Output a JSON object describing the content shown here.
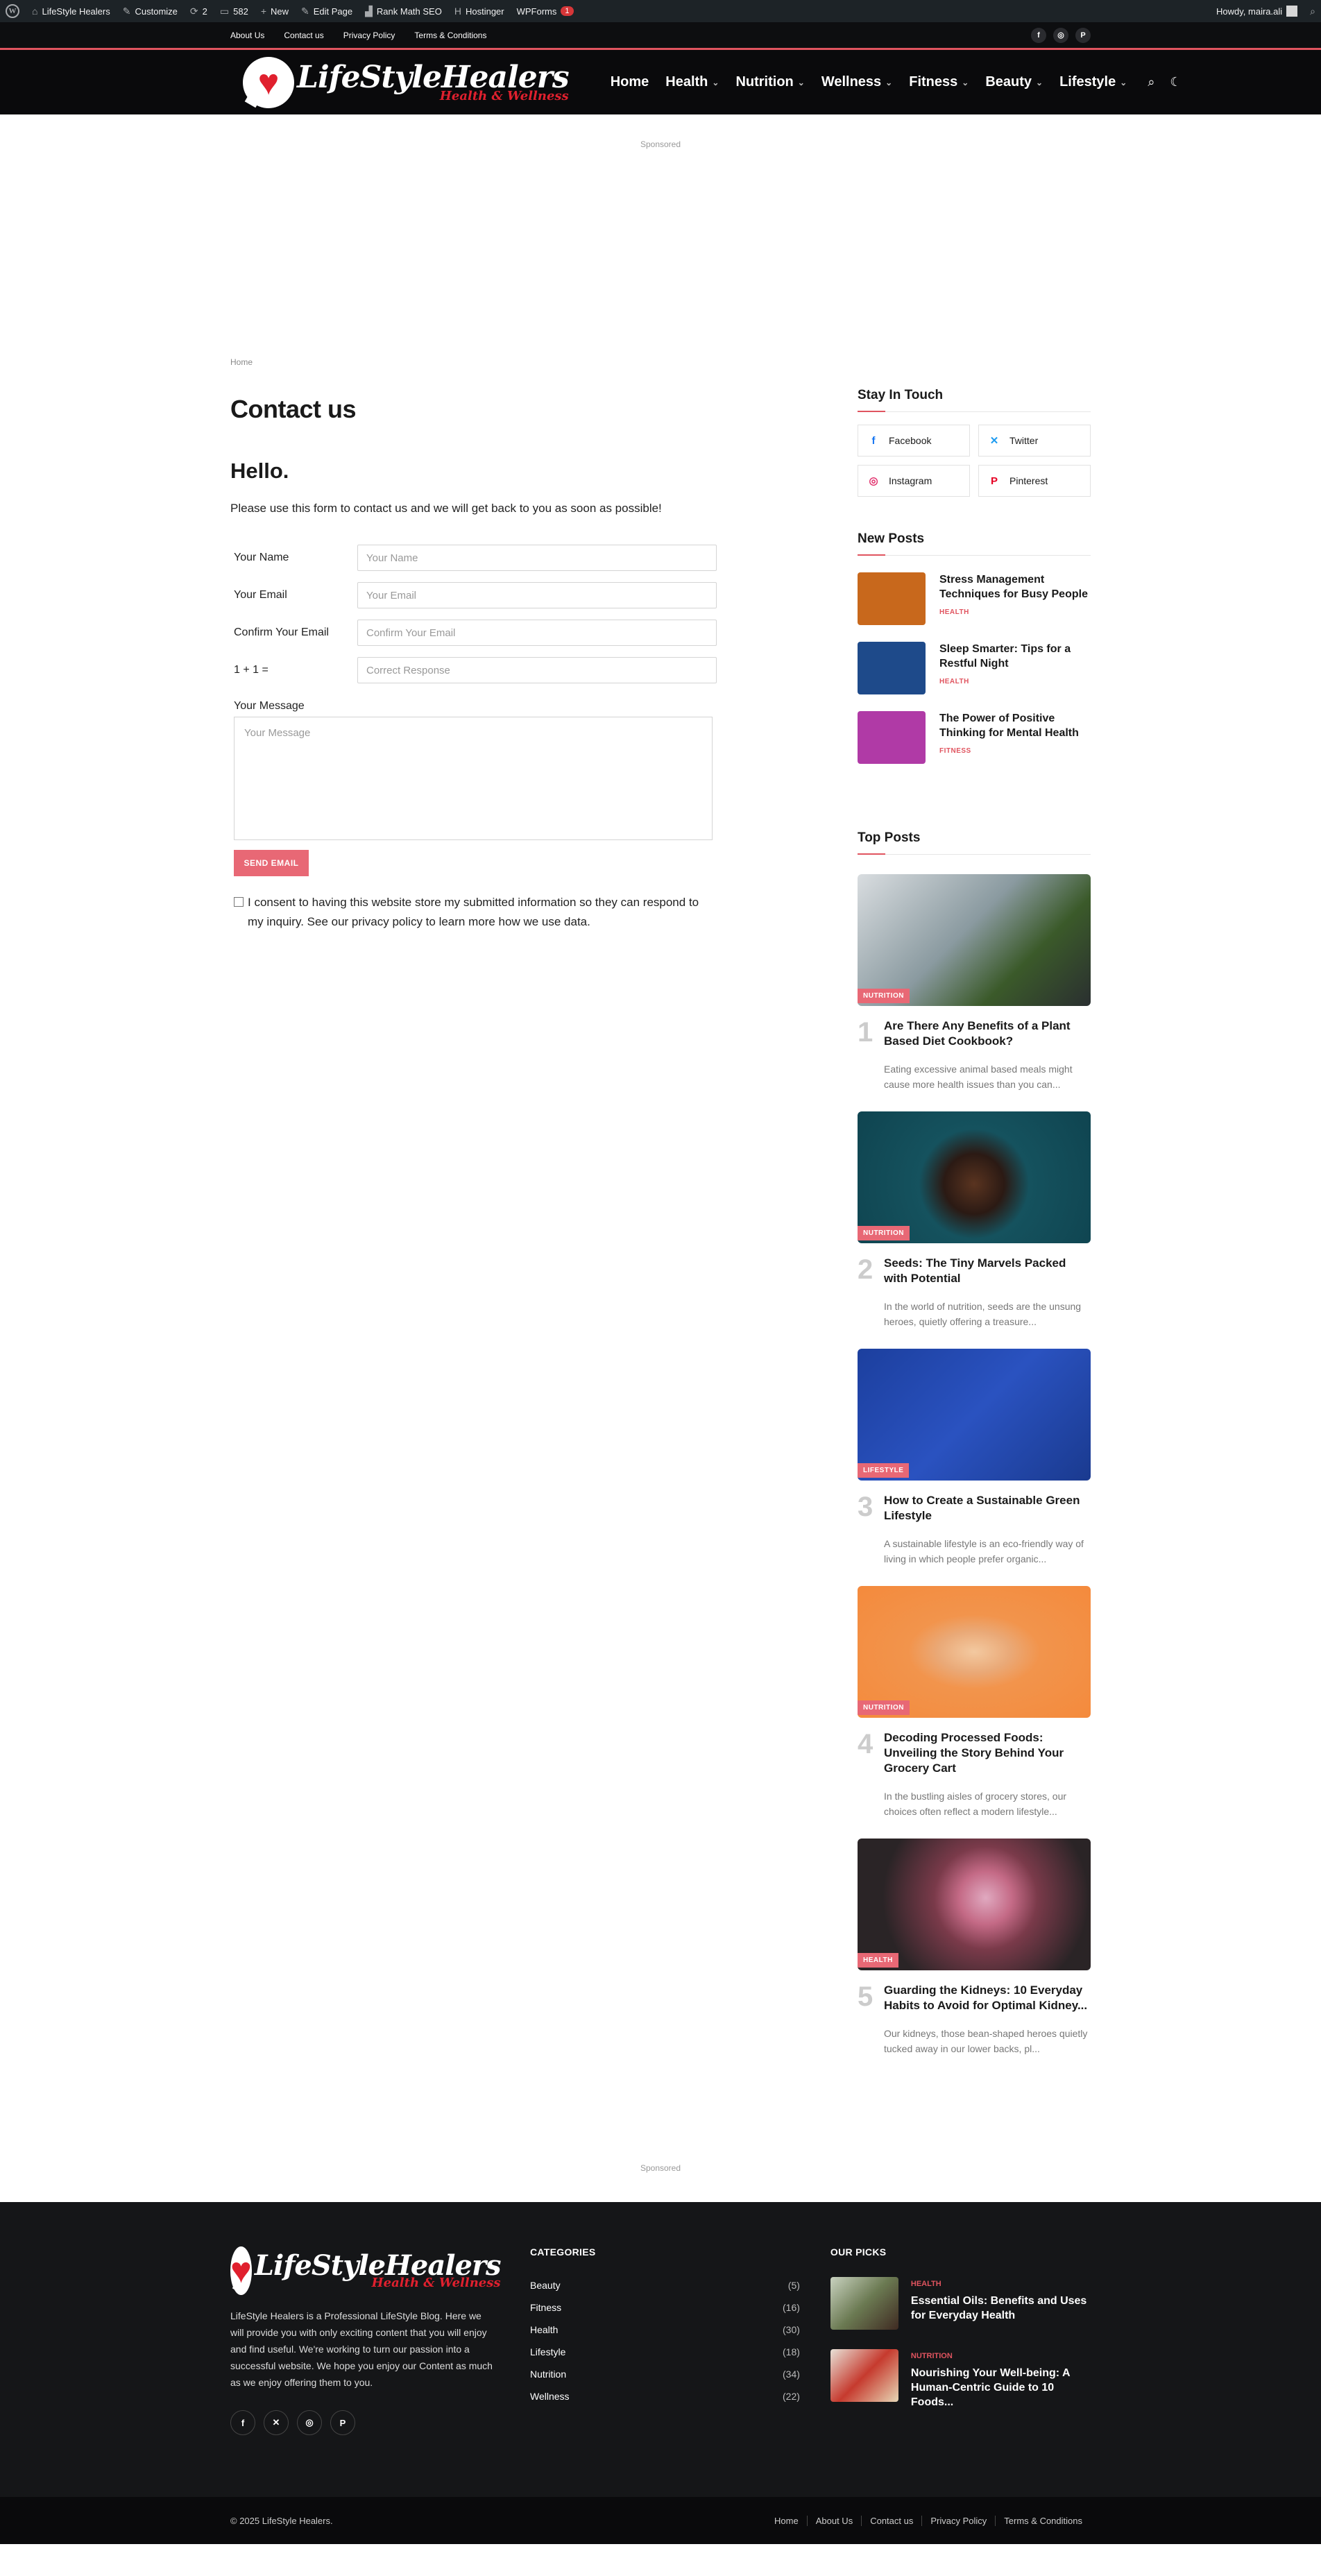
{
  "admin_bar": {
    "site": "LifeStyle Healers",
    "customize": "Customize",
    "updates": "2",
    "comments": "582",
    "new": "New",
    "edit_page": "Edit Page",
    "rank_math": "Rank Math SEO",
    "hostinger": "Hostinger",
    "wpforms": "WPForms",
    "wpforms_badge": "1",
    "howdy": "Howdy, maira.ali"
  },
  "top_links": [
    "About Us",
    "Contact us",
    "Privacy Policy",
    "Terms & Conditions"
  ],
  "top_socials": [
    "f",
    "◎",
    "P"
  ],
  "logo": {
    "main": "LifeStyleHealers",
    "sub": "Health & Wellness"
  },
  "nav": [
    {
      "label": "Home",
      "has_dropdown": false
    },
    {
      "label": "Health",
      "has_dropdown": true
    },
    {
      "label": "Nutrition",
      "has_dropdown": true
    },
    {
      "label": "Wellness",
      "has_dropdown": true
    },
    {
      "label": "Fitness",
      "has_dropdown": true
    },
    {
      "label": "Beauty",
      "has_dropdown": true
    },
    {
      "label": "Lifestyle",
      "has_dropdown": true
    }
  ],
  "sponsored": "Sponsored",
  "breadcrumb": "Home",
  "page_title": "Contact us",
  "hello": "Hello.",
  "intro": "Please use this form to contact us and we will get back to you as soon as possible!",
  "form": {
    "fields": [
      {
        "label": "Your Name",
        "placeholder": "Your Name"
      },
      {
        "label": "Your Email",
        "placeholder": "Your Email"
      },
      {
        "label": "Confirm Your Email",
        "placeholder": "Confirm Your Email"
      },
      {
        "label": "1 + 1 =",
        "placeholder": "Correct Response"
      }
    ],
    "message_label": "Your Message",
    "message_placeholder": "Your Message",
    "send": "SEND EMAIL",
    "consent": "I consent to having this website store my submitted information so they can respond to my inquiry. See our privacy policy to learn more how we use data."
  },
  "sidebar": {
    "stay_title": "Stay In Touch",
    "socials": [
      {
        "icon": "facebook-icon",
        "glyph": "f",
        "label": "Facebook",
        "color": "#1877f2"
      },
      {
        "icon": "x-icon",
        "glyph": "✕",
        "label": "Twitter",
        "color": "#1d9bf0"
      },
      {
        "icon": "instagram-icon",
        "glyph": "◎",
        "label": "Instagram",
        "color": "#e1306c"
      },
      {
        "icon": "pinterest-icon",
        "glyph": "P",
        "label": "Pinterest",
        "color": "#e60023"
      }
    ],
    "new_posts_title": "New Posts",
    "new_posts": [
      {
        "title": "Stress Management Techniques for Busy People",
        "cat": "HEALTH",
        "thumb": "#c8681c"
      },
      {
        "title": "Sleep Smarter: Tips for a Restful Night",
        "cat": "HEALTH",
        "thumb": "#1e4a8a"
      },
      {
        "title": "The Power of Positive Thinking for Mental Health",
        "cat": "FITNESS",
        "thumb": "#b03aa6"
      }
    ],
    "top_posts_title": "Top Posts",
    "top_posts": [
      {
        "num": "1",
        "cat": "NUTRITION",
        "title": "Are There Any Benefits of a Plant Based Diet Cookbook?",
        "excerpt": "Eating excessive animal based meals might cause more health issues than you can...",
        "img": "linear-gradient(135deg,#d9dde0 0%,#8a9aa0 45%,#3b5a2a 70%,#2a2f30 100%)"
      },
      {
        "num": "2",
        "cat": "NUTRITION",
        "title": "Seeds: The Tiny Marvels Packed with Potential",
        "excerpt": "In the world of nutrition, seeds are the unsung heroes, quietly offering a treasure...",
        "img": "radial-gradient(circle at 50% 55%,#5a3420 0%,#2b1a14 22%,#15525e 40%,#0f4450 100%)"
      },
      {
        "num": "3",
        "cat": "LIFESTYLE",
        "title": "How to Create a Sustainable Green Lifestyle",
        "excerpt": "A sustainable lifestyle is an eco-friendly way of living in which people prefer organic...",
        "img": "linear-gradient(135deg,#1c3f9e 0%,#2a52c0 50%,#1a3a8f 100%)"
      },
      {
        "num": "4",
        "cat": "NUTRITION",
        "title": "Decoding Processed Foods: Unveiling the Story Behind Your Grocery Cart",
        "excerpt": "In the bustling aisles of grocery stores, our choices often reflect a modern lifestyle...",
        "img": "radial-gradient(ellipse at 50% 50%,#f3c9a0 0%,#eaa977 22%,#f2944c 40%,#f48a3c 100%)"
      },
      {
        "num": "5",
        "cat": "HEALTH",
        "title": "Guarding the Kidneys: 10 Everyday Habits to Avoid for Optimal Kidney...",
        "excerpt": "Our kidneys, those bean-shaped heroes quietly tucked away in our lower backs, pl...",
        "img": "radial-gradient(circle at 55% 45%,#e0a9c0 0%,#c46a86 18%,#7a3a4a 35%,#2a2426 70%)"
      }
    ]
  },
  "footer": {
    "desc": "LifeStyle Healers is a Professional LifeStyle Blog. Here we will provide you with only exciting content that you will enjoy and find useful. We're working to turn our passion into a successful website. We hope you enjoy our Content as much as we enjoy offering them to you.",
    "socials": [
      "f",
      "✕",
      "◎",
      "P"
    ],
    "categories_title": "CATEGORIES",
    "categories": [
      {
        "name": "Beauty",
        "count": "(5)"
      },
      {
        "name": "Fitness",
        "count": "(16)"
      },
      {
        "name": "Health",
        "count": "(30)"
      },
      {
        "name": "Lifestyle",
        "count": "(18)"
      },
      {
        "name": "Nutrition",
        "count": "(34)"
      },
      {
        "name": "Wellness",
        "count": "(22)"
      }
    ],
    "picks_title": "OUR PICKS",
    "picks": [
      {
        "cat": "HEALTH",
        "title": "Essential Oils: Benefits and Uses for Everyday Health",
        "thumb": "linear-gradient(135deg,#c9d2c0,#6b7a52 50%,#3f2a22)"
      },
      {
        "cat": "NUTRITION",
        "title": "Nourishing Your Well-being: A Human-Centric Guide to 10 Foods...",
        "thumb": "linear-gradient(135deg,#e8e2d8,#c63a2e 50%,#e7d7b6)"
      }
    ],
    "copyright": "© 2025 LifeStyle Healers.",
    "bottom_links": [
      "Home",
      "About Us",
      "Contact us",
      "Privacy Policy",
      "Terms & Conditions"
    ]
  }
}
